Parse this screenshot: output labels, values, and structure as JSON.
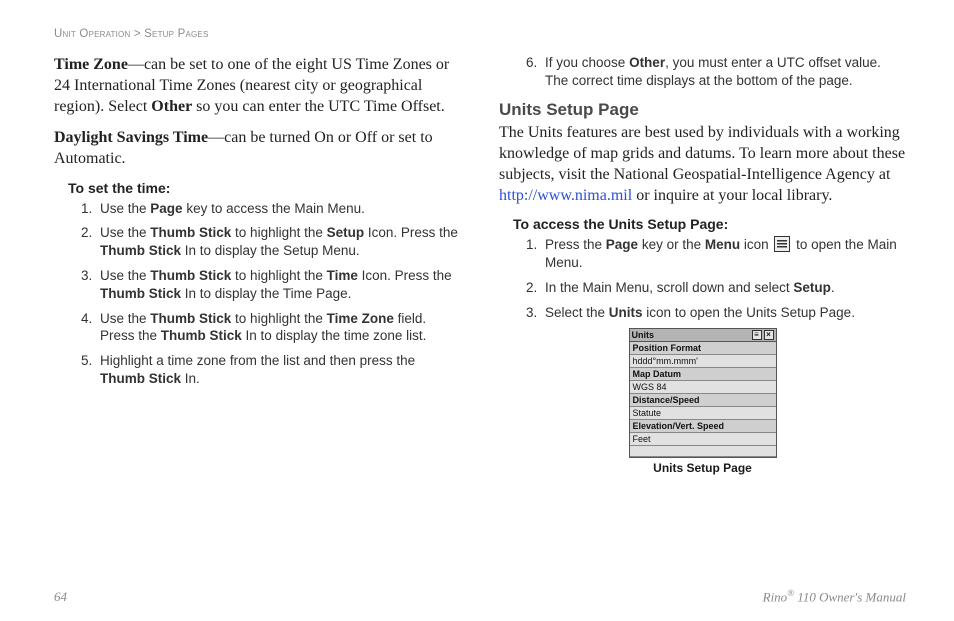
{
  "breadcrumb": {
    "a": "Unit Operation",
    "sep": ">",
    "b": "Setup Pages"
  },
  "left": {
    "p1": {
      "t1": "Time Zone",
      "t2": "—can be set to one of the eight US Time Zones or 24 International Time Zones (nearest city or geographical region). Select ",
      "t3": "Other",
      "t4": " so you can enter the UTC Time Offset."
    },
    "p2": {
      "t1": "Daylight Savings Time",
      "t2": "—can be turned On or Off or set to Automatic."
    },
    "h1": "To set the time:",
    "steps": [
      {
        "a": "Use the ",
        "b": "Page",
        "c": " key to access the Main Menu."
      },
      {
        "a": "Use the ",
        "b": "Thumb Stick",
        "c": " to highlight the ",
        "d": "Setup",
        "e": " Icon. Press the ",
        "f": "Thumb Stick",
        "g": " In to display the Setup Menu."
      },
      {
        "a": "Use the ",
        "b": "Thumb Stick",
        "c": " to highlight the ",
        "d": "Time",
        "e": " Icon. Press the ",
        "f": "Thumb Stick",
        "g": " In to display the Time Page."
      },
      {
        "a": "Use the ",
        "b": "Thumb Stick",
        "c": " to highlight the ",
        "d": "Time Zone",
        "e": " field. Press the ",
        "f": "Thumb Stick",
        "g": " In to display the time zone list."
      },
      {
        "a": "Highlight a time zone from the list and then press the ",
        "b": "Thumb Stick",
        "c": " In."
      }
    ]
  },
  "right": {
    "step6": {
      "a": "If you choose ",
      "b": "Other",
      "c": ", you must enter a UTC offset value. The correct time displays at the bottom of the page."
    },
    "h2": "Units Setup Page",
    "p3a": "The Units features are best used by individuals with a working knowledge of map grids and datums. To learn more about these subjects, visit the National Geospatial-Intelligence Agency at ",
    "p3link": "http://www.nima.mil",
    "p3b": " or inquire at your local library.",
    "h3": "To access the Units Setup Page:",
    "asteps": [
      {
        "a": "Press the ",
        "b": "Page",
        "c": " key or the ",
        "d": "Menu",
        "e": " icon ",
        "f": " to open the Main Menu."
      },
      {
        "a": "In the Main Menu, scroll down and select ",
        "b": "Setup",
        "c": "."
      },
      {
        "a": "Select the ",
        "b": "Units",
        "c": " icon to open the Units Setup Page."
      }
    ],
    "fig": {
      "title": "Units",
      "rows": [
        {
          "label": "Position Format",
          "val": "hddd°mm.mmm'"
        },
        {
          "label": "Map Datum",
          "val": "WGS 84"
        },
        {
          "label": "Distance/Speed",
          "val": "Statute"
        },
        {
          "label": "Elevation/Vert. Speed",
          "val": "Feet"
        }
      ],
      "caption": "Units Setup Page"
    }
  },
  "footer": {
    "page": "64",
    "manual_a": "Rino",
    "manual_b": " 110 Owner's Manual"
  }
}
